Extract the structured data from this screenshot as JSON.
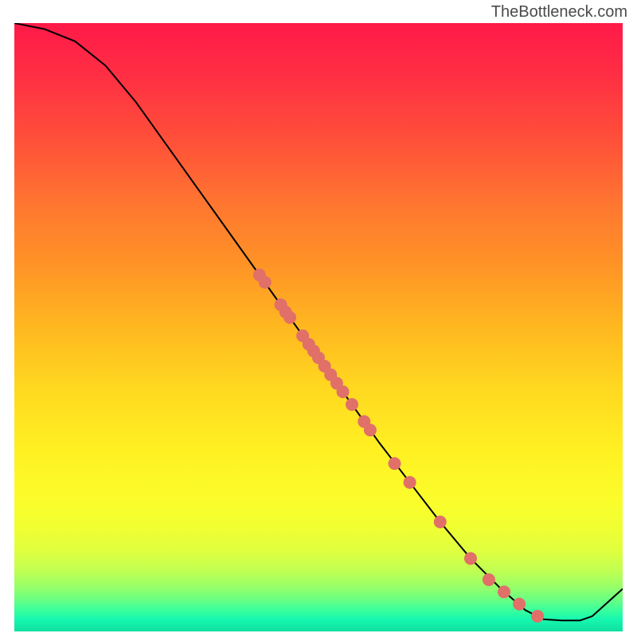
{
  "attribution": "TheBottleneck.com",
  "chart_data": {
    "type": "line",
    "title": "",
    "xlabel": "",
    "ylabel": "",
    "xlim": [
      0,
      100
    ],
    "ylim": [
      0,
      100
    ],
    "curve": [
      {
        "x": 0,
        "y": 100
      },
      {
        "x": 5,
        "y": 99
      },
      {
        "x": 10,
        "y": 97
      },
      {
        "x": 15,
        "y": 93
      },
      {
        "x": 20,
        "y": 87
      },
      {
        "x": 25,
        "y": 80
      },
      {
        "x": 30,
        "y": 73
      },
      {
        "x": 35,
        "y": 66
      },
      {
        "x": 40,
        "y": 59
      },
      {
        "x": 45,
        "y": 52
      },
      {
        "x": 50,
        "y": 45
      },
      {
        "x": 55,
        "y": 38
      },
      {
        "x": 60,
        "y": 31
      },
      {
        "x": 65,
        "y": 24.5
      },
      {
        "x": 70,
        "y": 18
      },
      {
        "x": 75,
        "y": 12
      },
      {
        "x": 80,
        "y": 7
      },
      {
        "x": 84,
        "y": 3.5
      },
      {
        "x": 87,
        "y": 2
      },
      {
        "x": 90,
        "y": 1.8
      },
      {
        "x": 93,
        "y": 1.8
      },
      {
        "x": 95,
        "y": 2.5
      },
      {
        "x": 100,
        "y": 7
      }
    ],
    "points": [
      {
        "x": 40.3,
        "y": 58.6
      },
      {
        "x": 41.2,
        "y": 57.4
      },
      {
        "x": 43.8,
        "y": 53.7
      },
      {
        "x": 44.6,
        "y": 52.5
      },
      {
        "x": 45.3,
        "y": 51.6
      },
      {
        "x": 47.4,
        "y": 48.6
      },
      {
        "x": 48.4,
        "y": 47.2
      },
      {
        "x": 49.2,
        "y": 46.1
      },
      {
        "x": 50.0,
        "y": 45.0
      },
      {
        "x": 51.0,
        "y": 43.6
      },
      {
        "x": 52.0,
        "y": 42.2
      },
      {
        "x": 53.0,
        "y": 40.8
      },
      {
        "x": 54.0,
        "y": 39.4
      },
      {
        "x": 55.5,
        "y": 37.3
      },
      {
        "x": 57.5,
        "y": 34.5
      },
      {
        "x": 58.5,
        "y": 33.1
      },
      {
        "x": 62.5,
        "y": 27.6
      },
      {
        "x": 65.0,
        "y": 24.5
      },
      {
        "x": 70.0,
        "y": 18.0
      },
      {
        "x": 75.0,
        "y": 12.0
      },
      {
        "x": 78.0,
        "y": 8.5
      },
      {
        "x": 80.5,
        "y": 6.5
      },
      {
        "x": 83.0,
        "y": 4.5
      },
      {
        "x": 86.0,
        "y": 2.5
      }
    ]
  }
}
